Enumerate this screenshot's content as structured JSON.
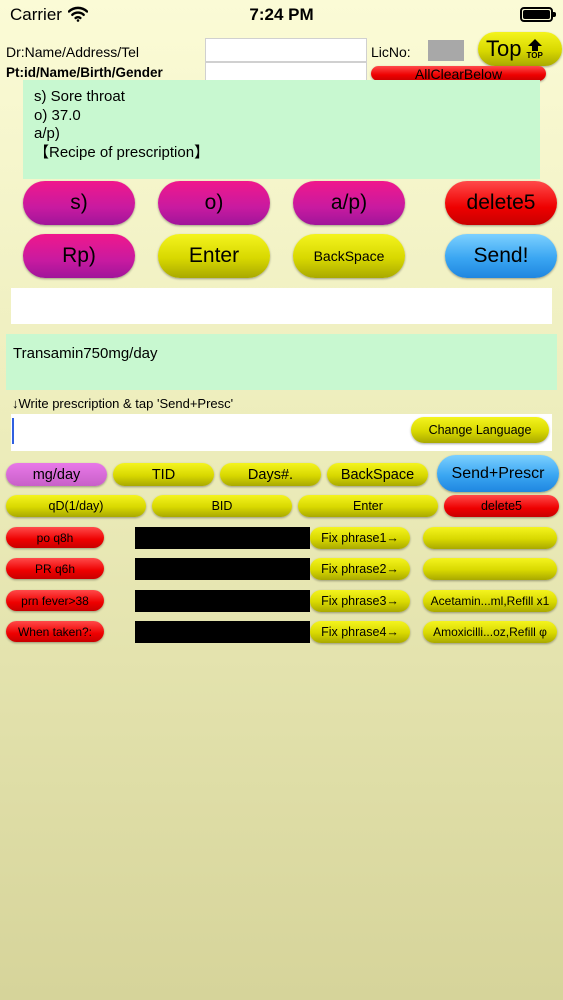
{
  "status_bar": {
    "carrier": "Carrier",
    "time": "7:24 PM"
  },
  "header": {
    "dr_label": "Dr:Name/Address/Tel",
    "pt_label": "Pt:id/Name/Birth/Gender",
    "lic_label": "LicNo:",
    "top_button": "Top",
    "top_sub": "TOP",
    "all_clear": "AllClearBelow"
  },
  "note": {
    "lines": [
      "s) Sore throat",
      "o) 37.0",
      "a/p)",
      "【Recipe of prescription】"
    ]
  },
  "soap_buttons": {
    "s": "s)",
    "o": "o)",
    "ap": "a/p)",
    "delete5": "delete5",
    "rp": "Rp)",
    "enter": "Enter",
    "backspace": "BackSpace",
    "send": "Send!"
  },
  "prescription_box": {
    "text": "Transamin750mg/day"
  },
  "hint": "↓Write prescription & tap 'Send+Presc'",
  "input_row": {
    "change_language": "Change Language",
    "value": ""
  },
  "keys_row1": {
    "mg_day": "mg/day",
    "tid": "TID",
    "days": "Days#.",
    "backspace": "BackSpace",
    "send_presc": "Send+Prescr"
  },
  "keys_row2": {
    "qd": "qD(1/day)",
    "bid": "BID",
    "enter": "Enter",
    "delete5": "delete5"
  },
  "phrases": [
    {
      "key": "po q8h",
      "fix": "Fix phrase1→",
      "value": ""
    },
    {
      "key": "PR q6h",
      "fix": "Fix phrase2→",
      "value": ""
    },
    {
      "key": "prn fever>38",
      "fix": "Fix phrase3→",
      "value": "Acetamin...ml,Refill x1"
    },
    {
      "key": "When taken?:",
      "fix": "Fix phrase4→",
      "value": "Amoxicilli...oz,Refill φ"
    }
  ]
}
